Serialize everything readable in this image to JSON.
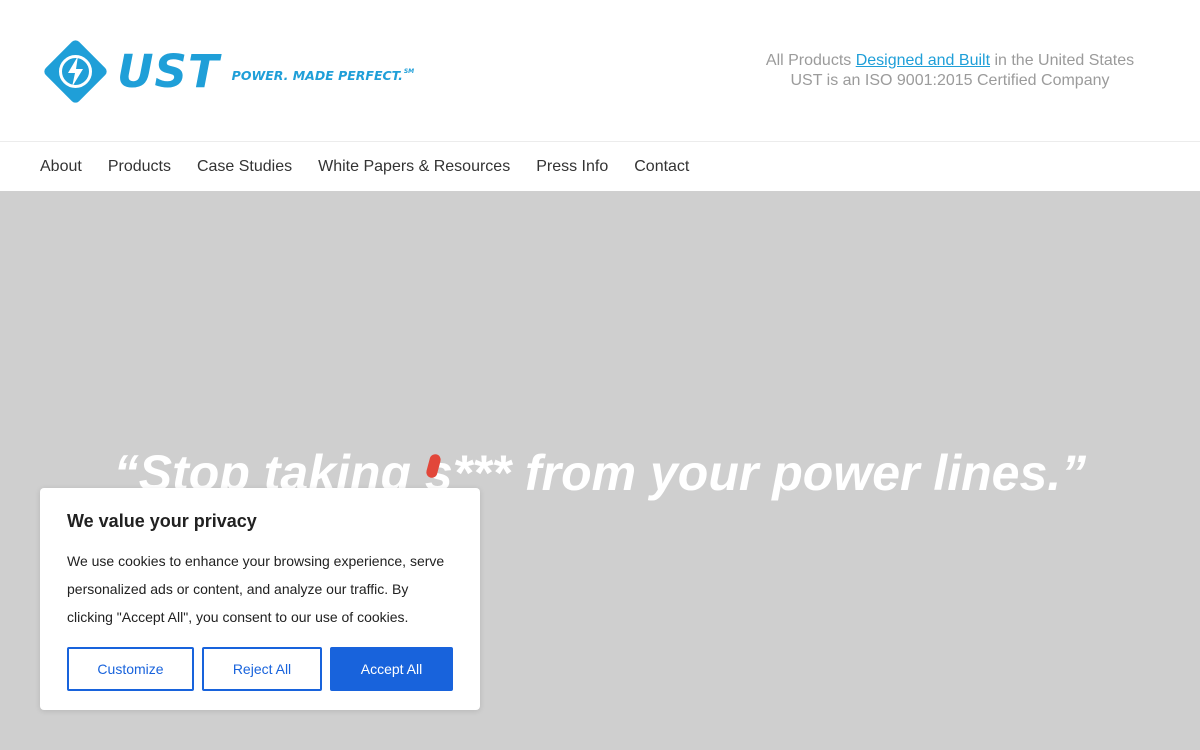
{
  "brand": {
    "name": "UST",
    "tagline": "POWER. MADE PERFECT.",
    "tm": "SM",
    "icon": "lightning-diamond-icon",
    "color": "#1f9fd8"
  },
  "header": {
    "line1_prefix": "All Products ",
    "line1_link": "Designed and Built",
    "line1_suffix": " in the United States",
    "line2": "UST is an ISO 9001:2015 Certified Company"
  },
  "nav": {
    "items": [
      {
        "label": "About"
      },
      {
        "label": "Products"
      },
      {
        "label": "Case Studies"
      },
      {
        "label": "White Papers & Resources"
      },
      {
        "label": "Press Info"
      },
      {
        "label": "Contact"
      }
    ]
  },
  "hero": {
    "headline": "“Stop taking s*** from your power lines.”",
    "background": "#cfcfcf"
  },
  "cookie_banner": {
    "title": "We value your privacy",
    "body": "We use cookies to enhance your browsing experience, serve personalized ads or content, and analyze our traffic. By clicking \"Accept All\", you consent to our use of cookies.",
    "customize_label": "Customize",
    "reject_label": "Reject All",
    "accept_label": "Accept All",
    "accent": "#1863dc"
  }
}
